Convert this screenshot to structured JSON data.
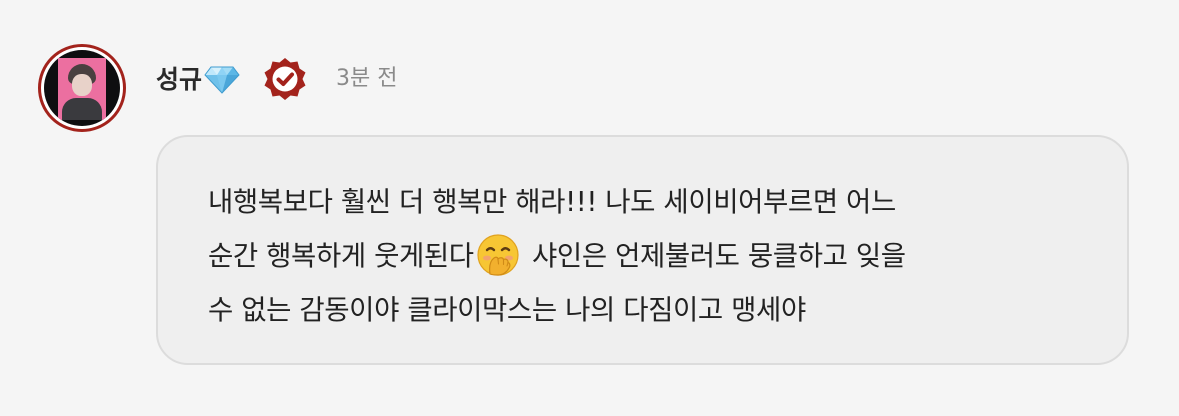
{
  "comment": {
    "author": {
      "name": "성규",
      "badge_icon": "diamond-icon",
      "verified_icon": "verified-badge-icon",
      "avatar_frame_color": "#a3231c"
    },
    "timestamp": "3분 전",
    "message": {
      "line1": "내행복보다 훨씬 더 행복만 해라!!! 나도 세이비어부르면 어느",
      "line2_before_emoji": "순간 행복하게 웃게된다",
      "emoji": "hand-over-mouth-emoji",
      "line2_after_emoji": " 샤인은 언제불러도 뭉클하고 잊을",
      "line3": "수 없는 감동이야 클라이막스는 나의 다짐이고 맹세야"
    }
  },
  "colors": {
    "background": "#f5f5f5",
    "bubble": "#efefef",
    "verified_badge": "#a3231c",
    "timestamp": "#8a8a8a"
  }
}
